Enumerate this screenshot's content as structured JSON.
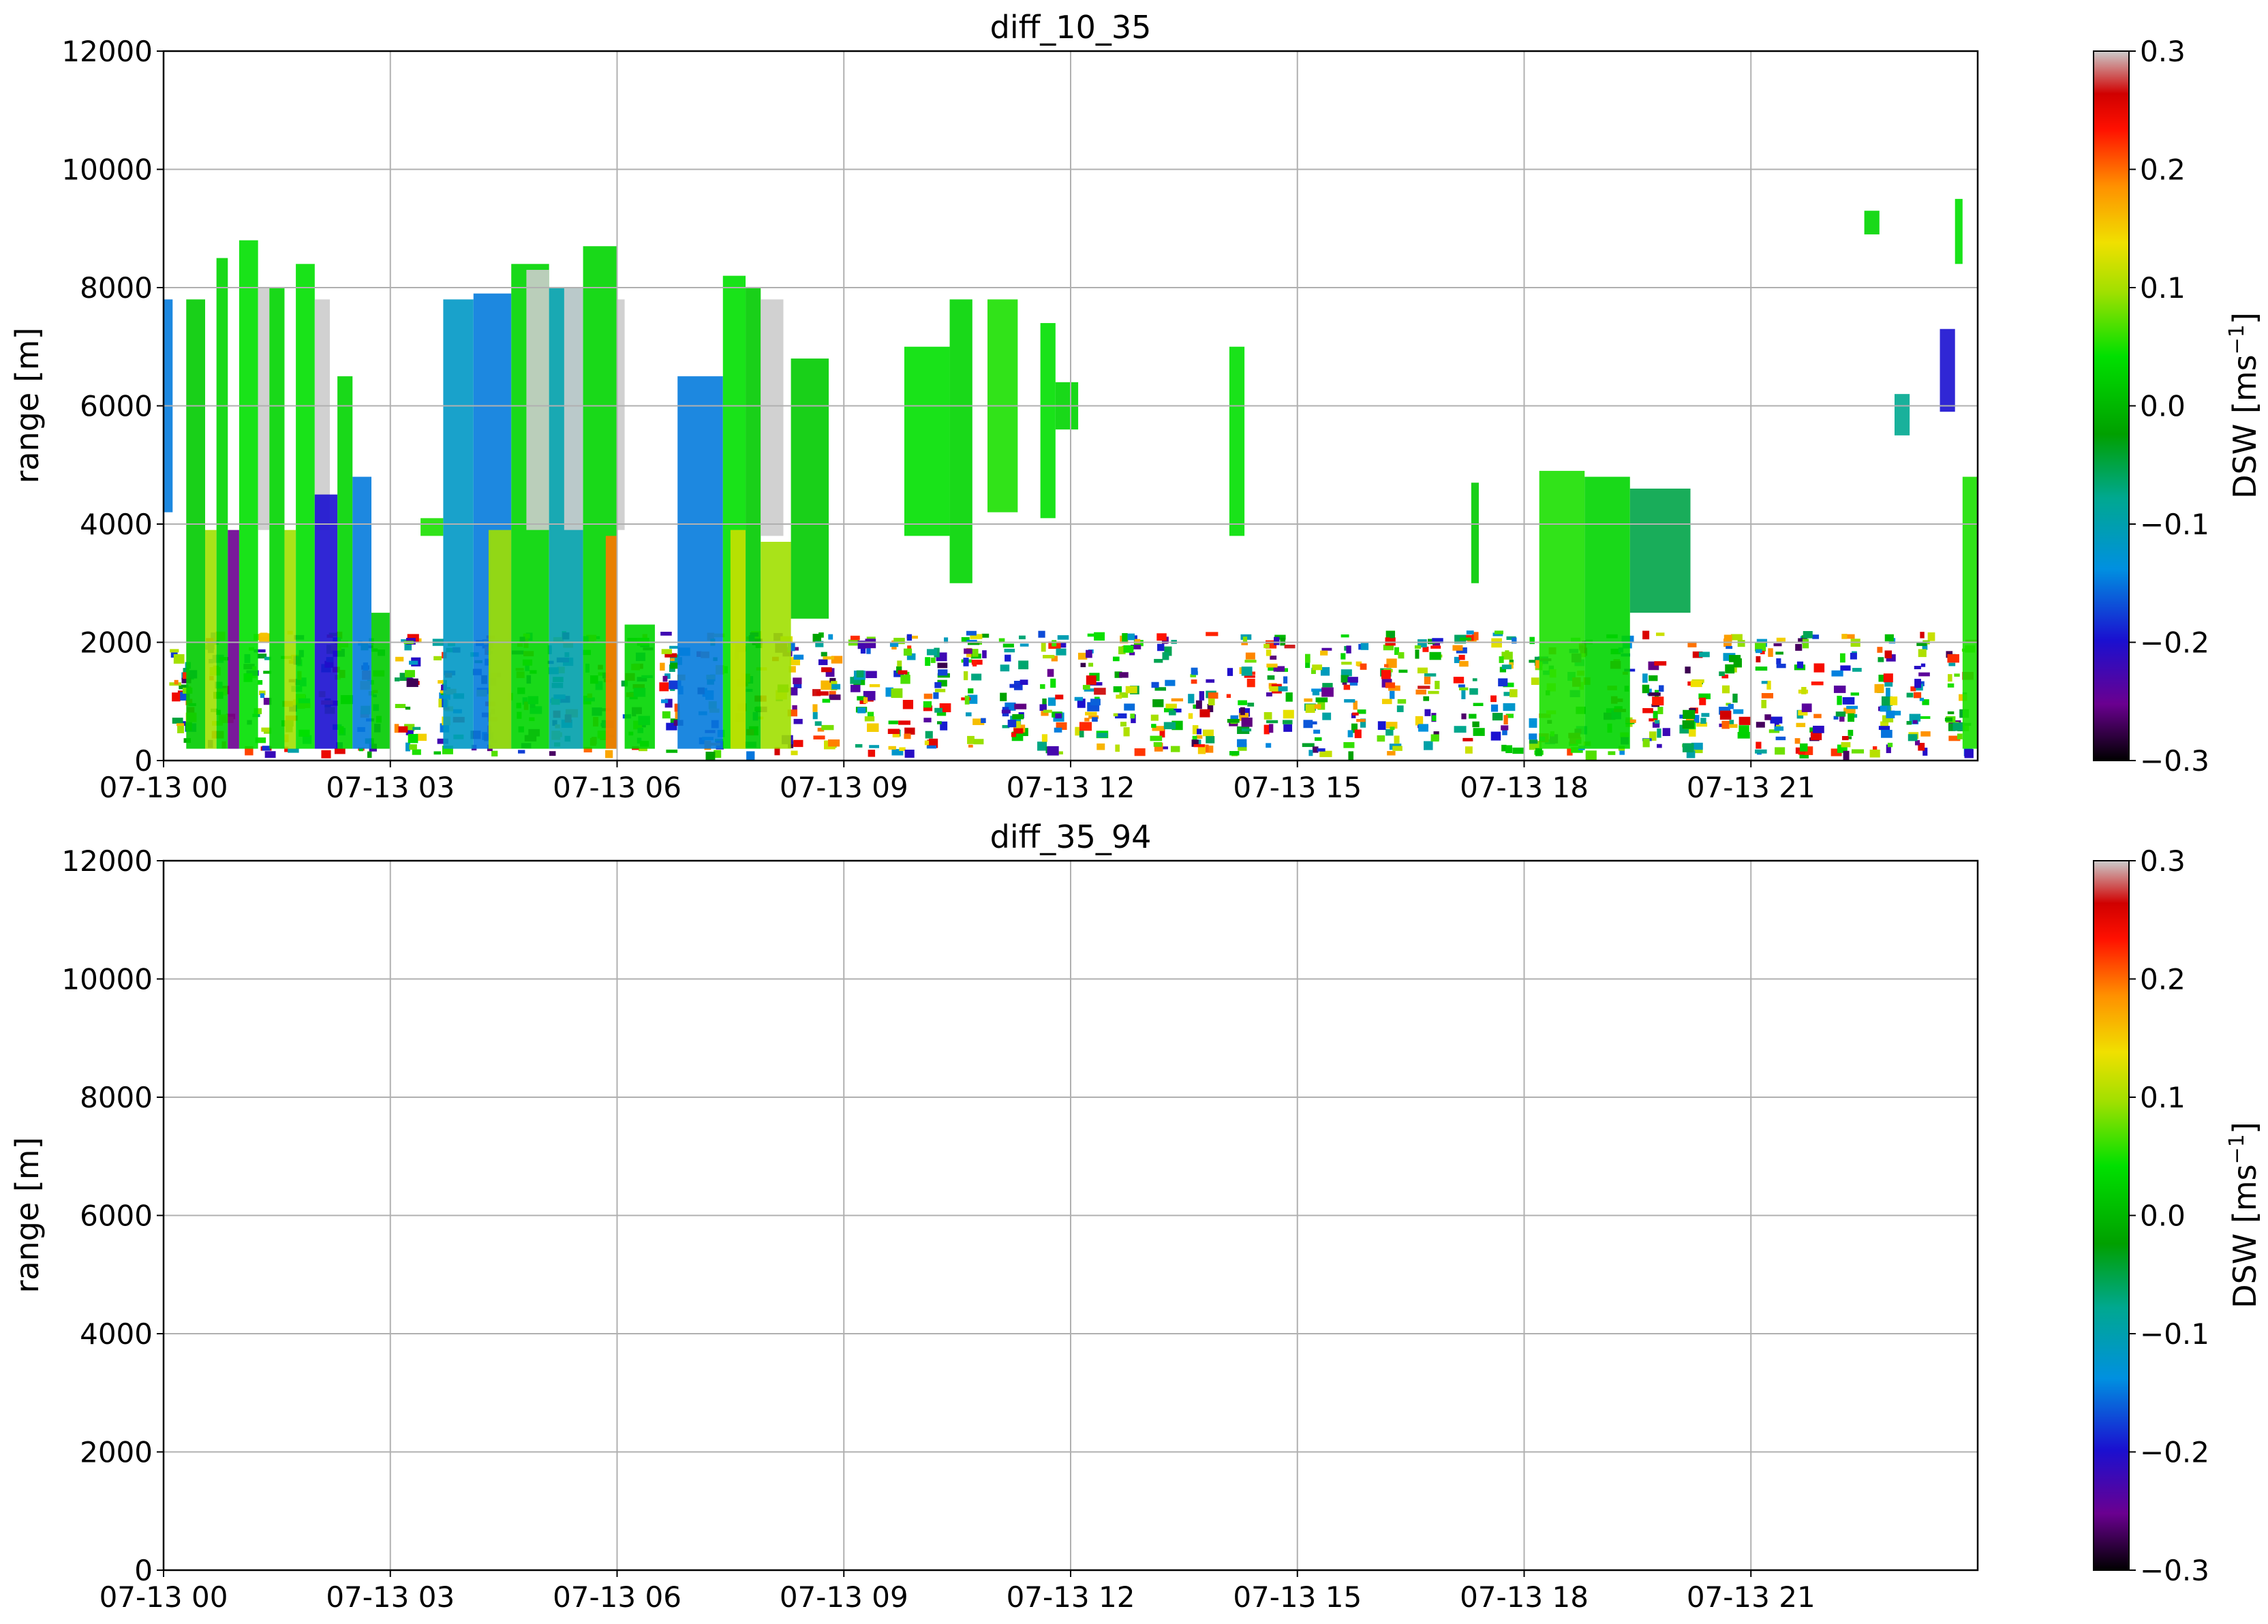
{
  "chart_data": [
    {
      "type": "heatmap",
      "title": "diff_10_35",
      "xlabel": "",
      "ylabel": "range [m]",
      "x_ticks": [
        "07-13 00",
        "07-13 03",
        "07-13 06",
        "07-13 09",
        "07-13 12",
        "07-13 15",
        "07-13 18",
        "07-13 21"
      ],
      "x_range_hours": [
        0,
        24
      ],
      "y_ticks": [
        0,
        2000,
        4000,
        6000,
        8000,
        10000,
        12000
      ],
      "ylim": [
        0,
        12000
      ],
      "grid": true,
      "colorbar": {
        "label": "DSW [ms",
        "label_sup": "−1",
        "label_end": "]",
        "ticks": [
          "0.3",
          "0.2",
          "0.1",
          "0.0",
          "−0.1",
          "−0.2",
          "−0.3"
        ],
        "range": [
          -0.3,
          0.3
        ]
      },
      "echo_blocks": [
        {
          "t0": 0.0,
          "t1": 0.12,
          "h0": 4200,
          "h1": 7800,
          "v": -0.15
        },
        {
          "t0": 0.3,
          "t1": 0.55,
          "h0": 200,
          "h1": 7800,
          "v": 0.02
        },
        {
          "t0": 0.55,
          "t1": 0.7,
          "h0": 200,
          "h1": 3900,
          "v": 0.1
        },
        {
          "t0": 0.7,
          "t1": 0.85,
          "h0": 200,
          "h1": 8500,
          "v": 0.03
        },
        {
          "t0": 0.85,
          "t1": 1.0,
          "h0": 200,
          "h1": 3900,
          "v": -0.25
        },
        {
          "t0": 1.0,
          "t1": 1.25,
          "h0": 200,
          "h1": 8800,
          "v": 0.04
        },
        {
          "t0": 1.25,
          "t1": 1.4,
          "h0": 3900,
          "h1": 8000,
          "v": 0.3
        },
        {
          "t0": 1.4,
          "t1": 1.6,
          "h0": 200,
          "h1": 8000,
          "v": 0.03
        },
        {
          "t0": 1.6,
          "t1": 1.75,
          "h0": 200,
          "h1": 3900,
          "v": 0.1
        },
        {
          "t0": 1.75,
          "t1": 2.0,
          "h0": 200,
          "h1": 8400,
          "v": 0.04
        },
        {
          "t0": 2.0,
          "t1": 2.2,
          "h0": 3900,
          "h1": 7800,
          "v": 0.3
        },
        {
          "t0": 2.0,
          "t1": 2.3,
          "h0": 200,
          "h1": 4500,
          "v": -0.2
        },
        {
          "t0": 2.3,
          "t1": 2.5,
          "h0": 200,
          "h1": 6500,
          "v": 0.03
        },
        {
          "t0": 2.5,
          "t1": 2.75,
          "h0": 200,
          "h1": 4800,
          "v": -0.15
        },
        {
          "t0": 2.75,
          "t1": 3.0,
          "h0": 200,
          "h1": 2500,
          "v": 0.02
        },
        {
          "t0": 3.4,
          "t1": 3.7,
          "h0": 3800,
          "h1": 4100,
          "v": 0.05
        },
        {
          "t0": 3.7,
          "t1": 4.1,
          "h0": 200,
          "h1": 7800,
          "v": -0.12
        },
        {
          "t0": 4.1,
          "t1": 4.6,
          "h0": 200,
          "h1": 7900,
          "v": -0.15
        },
        {
          "t0": 4.3,
          "t1": 4.6,
          "h0": 200,
          "h1": 3900,
          "v": 0.1
        },
        {
          "t0": 4.6,
          "t1": 5.1,
          "h0": 200,
          "h1": 8400,
          "v": 0.03
        },
        {
          "t0": 4.8,
          "t1": 5.1,
          "h0": 3900,
          "h1": 8300,
          "v": 0.3
        },
        {
          "t0": 5.1,
          "t1": 5.55,
          "h0": 200,
          "h1": 8000,
          "v": -0.1
        },
        {
          "t0": 5.3,
          "t1": 5.55,
          "h0": 3900,
          "h1": 8000,
          "v": 0.3
        },
        {
          "t0": 5.55,
          "t1": 6.0,
          "h0": 200,
          "h1": 8700,
          "v": 0.03
        },
        {
          "t0": 5.85,
          "t1": 6.0,
          "h0": 200,
          "h1": 3800,
          "v": 0.2
        },
        {
          "t0": 6.0,
          "t1": 6.1,
          "h0": 3900,
          "h1": 7800,
          "v": 0.3
        },
        {
          "t0": 6.1,
          "t1": 6.5,
          "h0": 200,
          "h1": 2300,
          "v": 0.03
        },
        {
          "t0": 6.8,
          "t1": 7.4,
          "h0": 200,
          "h1": 6500,
          "v": -0.15
        },
        {
          "t0": 7.4,
          "t1": 7.7,
          "h0": 200,
          "h1": 8200,
          "v": 0.04
        },
        {
          "t0": 7.5,
          "t1": 7.7,
          "h0": 200,
          "h1": 3900,
          "v": 0.12
        },
        {
          "t0": 7.7,
          "t1": 7.9,
          "h0": 200,
          "h1": 8000,
          "v": 0.02
        },
        {
          "t0": 7.9,
          "t1": 8.2,
          "h0": 3800,
          "h1": 7800,
          "v": 0.3
        },
        {
          "t0": 7.9,
          "t1": 8.3,
          "h0": 200,
          "h1": 3700,
          "v": 0.1
        },
        {
          "t0": 8.3,
          "t1": 8.8,
          "h0": 2400,
          "h1": 6800,
          "v": 0.02
        },
        {
          "t0": 9.8,
          "t1": 10.4,
          "h0": 3800,
          "h1": 7000,
          "v": 0.04
        },
        {
          "t0": 10.4,
          "t1": 10.7,
          "h0": 3000,
          "h1": 7800,
          "v": 0.03
        },
        {
          "t0": 10.9,
          "t1": 11.3,
          "h0": 4200,
          "h1": 7800,
          "v": 0.05
        },
        {
          "t0": 11.6,
          "t1": 11.8,
          "h0": 4100,
          "h1": 7400,
          "v": 0.04
        },
        {
          "t0": 11.8,
          "t1": 12.1,
          "h0": 5600,
          "h1": 6400,
          "v": 0.03
        },
        {
          "t0": 14.1,
          "t1": 14.3,
          "h0": 3800,
          "h1": 7000,
          "v": 0.04
        },
        {
          "t0": 17.3,
          "t1": 17.4,
          "h0": 3000,
          "h1": 4700,
          "v": 0.02
        },
        {
          "t0": 18.2,
          "t1": 18.8,
          "h0": 200,
          "h1": 4900,
          "v": 0.05
        },
        {
          "t0": 18.8,
          "t1": 19.4,
          "h0": 200,
          "h1": 4800,
          "v": 0.03
        },
        {
          "t0": 19.4,
          "t1": 20.2,
          "h0": 2500,
          "h1": 4600,
          "v": -0.05
        },
        {
          "t0": 22.9,
          "t1": 23.1,
          "h0": 5500,
          "h1": 6200,
          "v": -0.08
        },
        {
          "t0": 22.5,
          "t1": 22.7,
          "h0": 8900,
          "h1": 9300,
          "v": 0.03
        },
        {
          "t0": 23.7,
          "t1": 23.8,
          "h0": 8400,
          "h1": 9500,
          "v": 0.04
        },
        {
          "t0": 23.5,
          "t1": 23.7,
          "h0": 5900,
          "h1": 7300,
          "v": -0.2
        },
        {
          "t0": 23.8,
          "t1": 24.0,
          "h0": 200,
          "h1": 4800,
          "v": 0.05
        }
      ],
      "low_clutter_band": {
        "h0": 150,
        "h1": 2200,
        "t0": 0.0,
        "t1": 24.0
      }
    },
    {
      "type": "heatmap",
      "title": "diff_35_94",
      "xlabel": "",
      "ylabel": "range [m]",
      "x_ticks": [
        "07-13 00",
        "07-13 03",
        "07-13 06",
        "07-13 09",
        "07-13 12",
        "07-13 15",
        "07-13 18",
        "07-13 21"
      ],
      "x_range_hours": [
        0,
        24
      ],
      "y_ticks": [
        0,
        2000,
        4000,
        6000,
        8000,
        10000,
        12000
      ],
      "ylim": [
        0,
        12000
      ],
      "grid": true,
      "colorbar": {
        "label": "DSW [ms",
        "label_sup": "−1",
        "label_end": "]",
        "ticks": [
          "0.3",
          "0.2",
          "0.1",
          "0.0",
          "−0.1",
          "−0.2",
          "−0.3"
        ],
        "range": [
          -0.3,
          0.3
        ]
      },
      "echo_blocks": []
    }
  ],
  "colors": {
    "grid": "#b0b0b0",
    "axis": "#000000",
    "over_range": "#cccccc"
  }
}
